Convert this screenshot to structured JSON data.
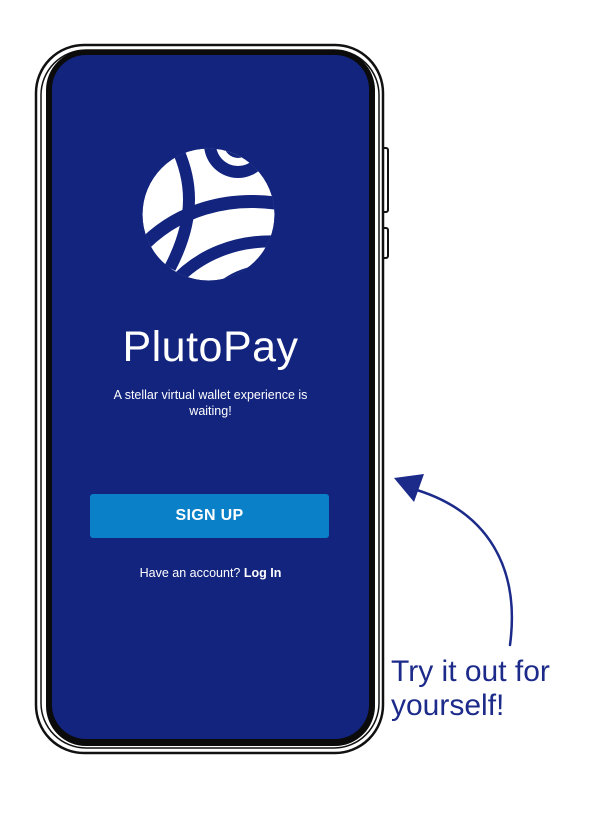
{
  "app": {
    "name": "PlutoPay",
    "tagline": "A stellar virtual wallet experience is waiting!",
    "logo_icon": "plutopay-planet-logo-icon"
  },
  "signup_button": {
    "label": "SIGN UP"
  },
  "login": {
    "prompt": "Have an account?",
    "link_label": "Log In"
  },
  "callout": {
    "text": "Try it out for yourself!",
    "arrow_icon": "curved-arrow-icon"
  },
  "colors": {
    "screen_background": "#12247e",
    "accent_button": "#0a80c8",
    "callout_text": "#1c2a8a",
    "text_on_screen": "#ffffff"
  }
}
